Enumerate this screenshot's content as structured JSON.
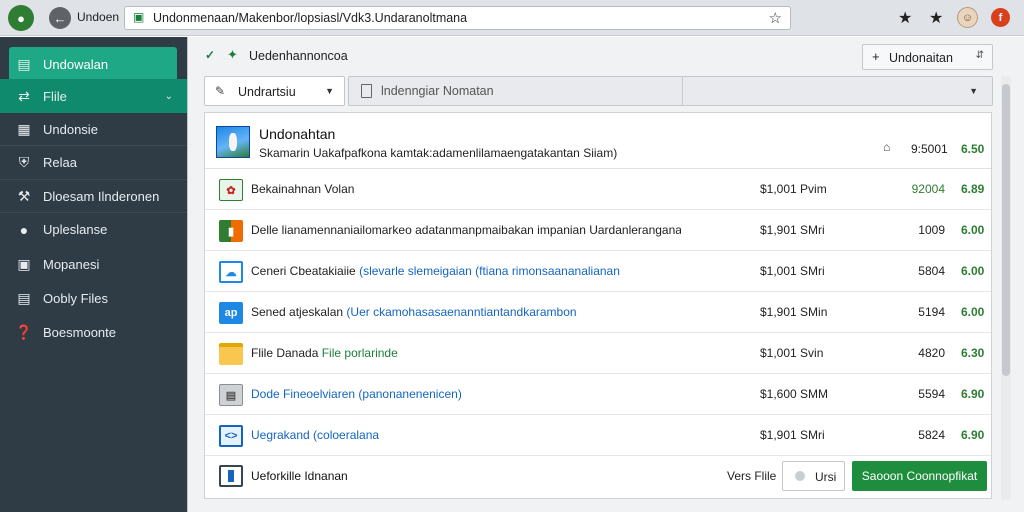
{
  "browser": {
    "tab_title": "Undoen",
    "url": "Undonmenaan/Makenbor/lopsiasl/Vdk3.Undaranoltmana"
  },
  "sidebar": {
    "items": [
      {
        "label": "Undowalan",
        "icon": "list-icon"
      },
      {
        "label": "Flile",
        "icon": "file-transfer-icon"
      },
      {
        "label": "Undonsie",
        "icon": "table-icon"
      },
      {
        "label": "Relaa",
        "icon": "shield-icon"
      },
      {
        "label": "Dloesam Ilnderonen",
        "icon": "wrench-icon"
      },
      {
        "label": "Upleslanse",
        "icon": "chat-icon"
      },
      {
        "label": "Mopanesi",
        "icon": "image-icon"
      },
      {
        "label": "Oobly Files",
        "icon": "chart-icon"
      },
      {
        "label": "Boesmoonte",
        "icon": "help-icon"
      }
    ]
  },
  "topbar": {
    "heading": "Uedenhannoncoa",
    "select_label": "Undonaitan"
  },
  "toolbar": {
    "filter_label": "Undrartsiu",
    "search_placeholder": "lndenngiar Nomatan"
  },
  "panel": {
    "header": {
      "title": "Undonahtan",
      "subtitle": "Skamarin Uakafpafkona kamtak:adamenlilamaengatakantan Siiam)",
      "price": "9:5001",
      "value": "6.50"
    },
    "rows": [
      {
        "title": "Bekainahnan Volan",
        "title_extra": "",
        "price": "$1,001 Pvim",
        "size": "92004",
        "size_green": true,
        "rating": "6.89",
        "icon": "image-file-icon",
        "icon_color": "#2e7d32"
      },
      {
        "title": "Delle lianamennaniailomarkeo adatanmanpmaibakan impanian Uardanleranganana",
        "title_extra": "",
        "price": "$1,901 SMri",
        "size": "1009",
        "size_green": false,
        "rating": "6.00",
        "icon": "slides-file-icon",
        "icon_color": "#c62828"
      },
      {
        "title": "Ceneri Cbeatakiaiie",
        "title_extra": "(slevarle slemeigaian (ftiana rimonsaananalianan",
        "price": "$1,001 SMri",
        "size": "5804",
        "size_green": false,
        "rating": "6.00",
        "icon": "cloud-file-icon",
        "icon_color": "#1565c0"
      },
      {
        "title": "Sened atjeskalan",
        "title_extra": "(Uer ckamohasasaenanntiantandkarambon",
        "price": "$1,901 SMin",
        "size": "5194",
        "size_green": false,
        "rating": "6.00",
        "icon": "app-file-icon",
        "icon_color": "#1565c0"
      },
      {
        "title": "Flile Danada",
        "title_extra": "File porlarinde",
        "price": "$1,001 Svin",
        "size": "4820",
        "size_green": false,
        "rating": "6.30",
        "icon": "folder-icon",
        "icon_color": "#f9a825"
      },
      {
        "title": "",
        "title_extra": "Dode Fineoelviaren (panonanenenicen)",
        "price": "$1,600 SMM",
        "size": "5594",
        "size_green": false,
        "rating": "6.90",
        "icon": "generic-file-icon",
        "icon_color": "#9e9e9e"
      },
      {
        "title": "",
        "title_extra": "Uegrakand (coloeralana",
        "price": "$1,901 SMri",
        "size": "5824",
        "size_green": false,
        "rating": "6.90",
        "icon": "code-file-icon",
        "icon_color": "#1565c0"
      }
    ],
    "footer": {
      "label": "Ueforkille Idnanan",
      "version": "Vers Flile",
      "toggle_label": "Ursi",
      "action_label": "Saooon Coonnopfikat"
    }
  },
  "colors": {
    "sidebar_bg": "#2f3b45",
    "sidebar_active": "#1ea886",
    "accent_green": "#1e8e3e"
  }
}
